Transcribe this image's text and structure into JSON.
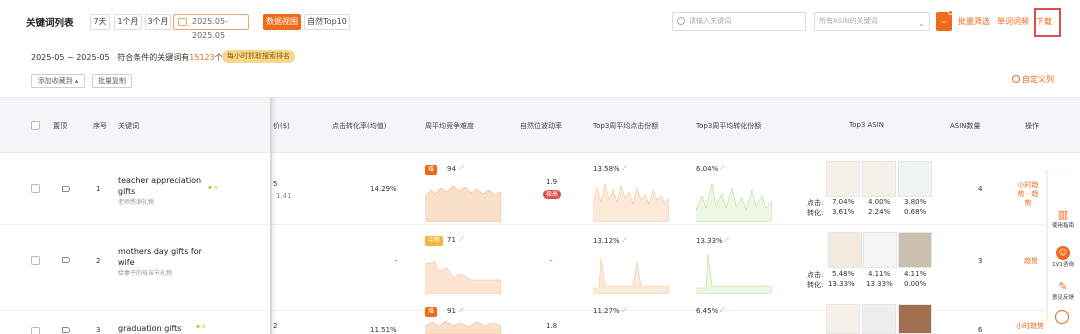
{
  "toolbar": {
    "title": "关键词列表",
    "range_buttons": [
      "7天",
      "1个月",
      "3个月"
    ],
    "date_range": "2025.05-2025.05",
    "tab_active": "数据视图",
    "tab_inactive": "自然Top10",
    "search_placeholder": "请输入关键词",
    "asin_placeholder": "所有ASIN的关键词",
    "links": [
      "批量筛选",
      "单词词频",
      "下载"
    ]
  },
  "summary": {
    "period": "2025-05 ~ 2025-05",
    "prefix": "符合条件的关键词有",
    "count": "15123",
    "suffix": "个",
    "badge": "每小时抓取搜索排名"
  },
  "actions": {
    "add_collection": "添加收藏到 ▴",
    "batch_copy": "批量复制",
    "custom_columns": "自定义列"
  },
  "columns": {
    "pin": "置顶",
    "index": "序号",
    "keyword": "关键词",
    "price": "价($)",
    "conv_rate": "点击转化率(均值)",
    "competition": "周平均竞争难度",
    "natural_rank": "自然位波动率",
    "top3_click": "Top3周平均点击份额",
    "top3_conv": "Top3周平均转化份额",
    "top3_asin": "Top3 ASIN",
    "asin_count": "ASIN数量",
    "operation": "操作"
  },
  "rows": [
    {
      "index": "1",
      "keyword_line1": "teacher appreciation",
      "keyword_line2": "gifts",
      "keyword_cn": "老师感谢礼物",
      "price_top": "5",
      "price_bottom": "1.41",
      "conv_rate": "14.29%",
      "comp_badge": "难",
      "comp_value": "94",
      "natural_rank": "1.9",
      "natural_tag": "极高",
      "top3_click": "13.58%",
      "top3_conv": "6.04%",
      "asin_clicks": [
        "7.04%",
        "4.00%",
        "3.80%"
      ],
      "asin_convs": [
        "3.61%",
        "2.24%",
        "0.68%"
      ],
      "asin_count": "4",
      "op": "小时趋势 · 趋势"
    },
    {
      "index": "2",
      "keyword_line1": "mothers day gifts for",
      "keyword_line2": "wife",
      "keyword_cn": "给妻子的母亲节礼物",
      "price_top": "",
      "price_bottom": "",
      "conv_rate": "-",
      "comp_badge": "中等",
      "comp_value": "71",
      "natural_rank": "-",
      "natural_tag": "",
      "top3_click": "13.12%",
      "top3_conv": "13.33%",
      "asin_clicks": [
        "5.48%",
        "4.11%",
        "4.11%"
      ],
      "asin_convs": [
        "13.33%",
        "13.33%",
        "0.00%"
      ],
      "asin_count": "3",
      "op": "趋势"
    },
    {
      "index": "3",
      "keyword_line1": "graduation gifts",
      "keyword_line2": "",
      "keyword_cn": "",
      "price_top": "2",
      "price_bottom": "",
      "conv_rate": "11.51%",
      "comp_badge": "难",
      "comp_value": "91",
      "natural_rank": "1.8",
      "natural_tag": "",
      "top3_click": "11.27%",
      "top3_conv": "6.45%",
      "asin_clicks": [],
      "asin_convs": [],
      "asin_count": "6",
      "op": "小时趋势"
    }
  ],
  "asin_labels": {
    "click": "点击:",
    "conv": "转化:"
  },
  "sidebar": {
    "guide": "使用指南",
    "consult": "1V1咨询",
    "feedback": "意见反馈"
  },
  "colors": {
    "accent": "#f06a1a",
    "hard": "#f06a1a",
    "medium": "#f5b53a",
    "chart_warm": "#f6cfa4",
    "chart_green": "#cfe8b5"
  }
}
